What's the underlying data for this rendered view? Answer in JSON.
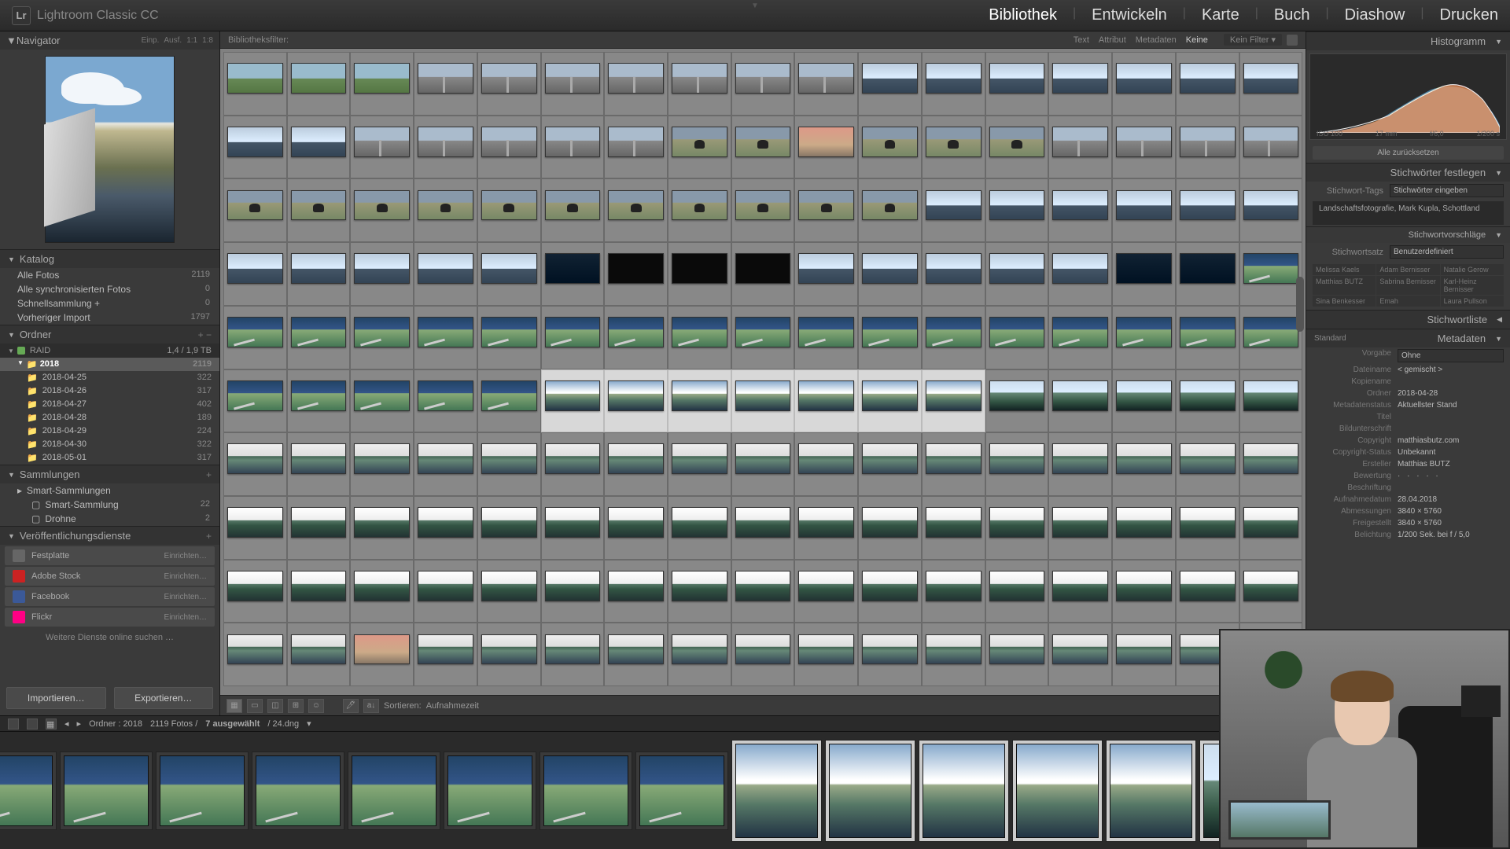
{
  "app": {
    "name": "Lightroom Classic CC",
    "logo_text": "Lr"
  },
  "modules": [
    "Bibliothek",
    "Entwickeln",
    "Karte",
    "Buch",
    "Diashow",
    "Drucken"
  ],
  "active_module": 0,
  "left": {
    "navigator": {
      "title": "Navigator",
      "zooms": [
        "Einp.",
        "Ausf.",
        "1:1",
        "1:8"
      ]
    },
    "katalog": {
      "title": "Katalog",
      "items": [
        {
          "label": "Alle Fotos",
          "count": "2119"
        },
        {
          "label": "Alle synchronisierten Fotos",
          "count": "0"
        },
        {
          "label": "Schnellsammlung  +",
          "count": "0"
        },
        {
          "label": "Vorheriger Import",
          "count": "1797"
        }
      ]
    },
    "ordner": {
      "title": "Ordner",
      "volume": {
        "name": "RAID",
        "free": "1,4 / 1,9 TB"
      },
      "year": {
        "label": "2018",
        "count": "2119"
      },
      "dates": [
        {
          "label": "2018-04-25",
          "count": "322"
        },
        {
          "label": "2018-04-26",
          "count": "317"
        },
        {
          "label": "2018-04-27",
          "count": "402"
        },
        {
          "label": "2018-04-28",
          "count": "189"
        },
        {
          "label": "2018-04-29",
          "count": "224"
        },
        {
          "label": "2018-04-30",
          "count": "322"
        },
        {
          "label": "2018-05-01",
          "count": "317"
        }
      ]
    },
    "sammlungen": {
      "title": "Sammlungen",
      "items": [
        {
          "label": "Smart-Sammlungen",
          "count": ""
        },
        {
          "label": "Smart-Sammlung",
          "count": "22"
        },
        {
          "label": "Drohne",
          "count": "2"
        }
      ]
    },
    "publish": {
      "title": "Veröffentlichungsdienste",
      "services": [
        {
          "name": "Festplatte",
          "color": "#666",
          "action": "Einrichten…"
        },
        {
          "name": "Adobe Stock",
          "color": "#c22",
          "action": "Einrichten…"
        },
        {
          "name": "Facebook",
          "color": "#3b5998",
          "action": "Einrichten…"
        },
        {
          "name": "Flickr",
          "color": "#ff0084",
          "action": "Einrichten…"
        }
      ],
      "more": "Weitere Dienste online suchen …"
    },
    "import": "Importieren…",
    "export": "Exportieren…"
  },
  "filter": {
    "label": "Bibliotheksfilter:",
    "tabs": [
      "Text",
      "Attribut",
      "Metadaten",
      "Keine"
    ],
    "nofilter": "Kein Filter"
  },
  "grid_rows": [
    [
      "sky",
      "sky",
      "sky",
      "road",
      "road",
      "road",
      "road",
      "road",
      "road",
      "road",
      "sil",
      "sil",
      "sil",
      "sil",
      "sil",
      "sil",
      "sil"
    ],
    [
      "sil",
      "sil",
      "road",
      "road",
      "road",
      "road",
      "road",
      "cow",
      "cow",
      "red",
      "cow",
      "cow",
      "cow",
      "road",
      "road",
      "road",
      "road"
    ],
    [
      "cow",
      "cow",
      "cow",
      "cow",
      "cow",
      "cow",
      "cow",
      "cow",
      "cow",
      "cow",
      "cow",
      "sil",
      "sil",
      "sil",
      "sil",
      "sil",
      "sil"
    ],
    [
      "sil",
      "sil",
      "sil",
      "sil",
      "sil",
      "dark",
      "dark2",
      "dark2",
      "dark2",
      "sil",
      "sil",
      "sil",
      "sil",
      "sil",
      "dark",
      "dark",
      "sea"
    ],
    [
      "sea",
      "sea",
      "sea",
      "sea",
      "sea",
      "sea",
      "sea",
      "sea",
      "sea",
      "sea",
      "sea",
      "sea",
      "sea",
      "sea",
      "sea",
      "sea",
      "sea"
    ],
    [
      "sea",
      "sea",
      "sea",
      "sea",
      "sea",
      "bridge",
      "bridge",
      "bridge",
      "bridge",
      "bridge",
      "bridge",
      "bridge",
      "bay",
      "bay",
      "bay",
      "bay",
      "bay"
    ],
    [
      "lake",
      "lake",
      "lake",
      "lake",
      "lake",
      "lake",
      "lake",
      "lake",
      "lake",
      "lake",
      "lake",
      "lake",
      "lake",
      "lake",
      "lake",
      "lake",
      "lake"
    ],
    [
      "lake2",
      "lake2",
      "lake2",
      "lake2",
      "lake2",
      "lake2",
      "lake2",
      "lake2",
      "lake2",
      "lake2",
      "lake2",
      "lake2",
      "lake2",
      "lake2",
      "lake2",
      "lake2",
      "lake2"
    ],
    [
      "lake2",
      "lake2",
      "lake2",
      "lake2",
      "lake2",
      "lake2",
      "lake2",
      "lake2",
      "lake2",
      "lake2",
      "lake2",
      "lake2",
      "lake2",
      "lake2",
      "lake2",
      "lake2",
      "lake2"
    ],
    [
      "lake",
      "lake",
      "red",
      "lake",
      "lake",
      "lake",
      "lake",
      "lake",
      "lake",
      "lake",
      "lake",
      "lake",
      "lake",
      "lake",
      "lake",
      "lake",
      "lake"
    ]
  ],
  "selected_cells": [
    [
      5,
      5
    ],
    [
      5,
      6
    ],
    [
      5,
      7
    ],
    [
      5,
      8
    ],
    [
      5,
      9
    ],
    [
      5,
      10
    ],
    [
      5,
      11
    ]
  ],
  "toolbar": {
    "sort_label": "Sortieren:",
    "sort_value": "Aufnahmezeit"
  },
  "status": {
    "path": "Ordner : 2018",
    "count": "2119 Fotos /",
    "selected": "7 ausgewählt",
    "file": "/ 24.dng"
  },
  "filmstrip": [
    "sea",
    "sea",
    "sea",
    "sea",
    "sea",
    "sea",
    "sea",
    "sea",
    "bridge",
    "bridge",
    "bridge",
    "bridge",
    "bridge",
    "bay",
    "bay",
    "bay"
  ],
  "filmstrip_sel": [
    8,
    9,
    10,
    11,
    12,
    13,
    14
  ],
  "right": {
    "histogram": "Histogramm",
    "histo_labels": [
      "ISO 100",
      "17 mm",
      "f/6,0",
      "1/200 s"
    ],
    "reset": "Alle zurücksetzen",
    "kw_header": "Stichwörter festlegen",
    "kw_tags_label": "Stichwort-Tags",
    "kw_tags_mode": "Stichwörter eingeben",
    "kw_tags_value": "Landschaftsfotografie, Mark Kupla, Schottland",
    "kw_sugg_header": "Stichwortvorschläge",
    "kw_set_label": "Stichwortsatz",
    "kw_set_value": "Benutzerdefiniert",
    "kw_suggestions": [
      "Melissa Kaels",
      "Adam Bernisser",
      "Natalie Gerow",
      "Matthias BUTZ",
      "Sabrina Bernisser",
      "Karl-Heinz Bernisser",
      "Sina Benkesser",
      "Emah",
      "Laura Pullson"
    ],
    "kw_list_header": "Stichwortliste",
    "meta_header": "Metadaten",
    "meta_preset_label": "Standard",
    "meta_mode": "Vorgabe",
    "meta_mode_val": "Ohne",
    "meta": [
      {
        "l": "Dateiname",
        "v": "< gemischt >"
      },
      {
        "l": "Kopiename",
        "v": ""
      },
      {
        "l": "Ordner",
        "v": "2018-04-28"
      },
      {
        "l": "Metadatenstatus",
        "v": "Aktuellster Stand"
      },
      {
        "l": "Titel",
        "v": ""
      },
      {
        "l": "Bildunterschrift",
        "v": ""
      },
      {
        "l": "Copyright",
        "v": "matthiasbutz.com"
      },
      {
        "l": "Copyright-Status",
        "v": "Unbekannt"
      },
      {
        "l": "Ersteller",
        "v": "Matthias BUTZ"
      },
      {
        "l": "Bewertung",
        "v": "· · · · ·"
      },
      {
        "l": "Beschriftung",
        "v": ""
      },
      {
        "l": "Aufnahmedatum",
        "v": "28.04.2018"
      },
      {
        "l": "Abmessungen",
        "v": "3840 × 5760"
      },
      {
        "l": "Freigestellt",
        "v": "3840 × 5760"
      },
      {
        "l": "Belichtung",
        "v": "1/200 Sek. bei f / 5,0"
      }
    ]
  }
}
